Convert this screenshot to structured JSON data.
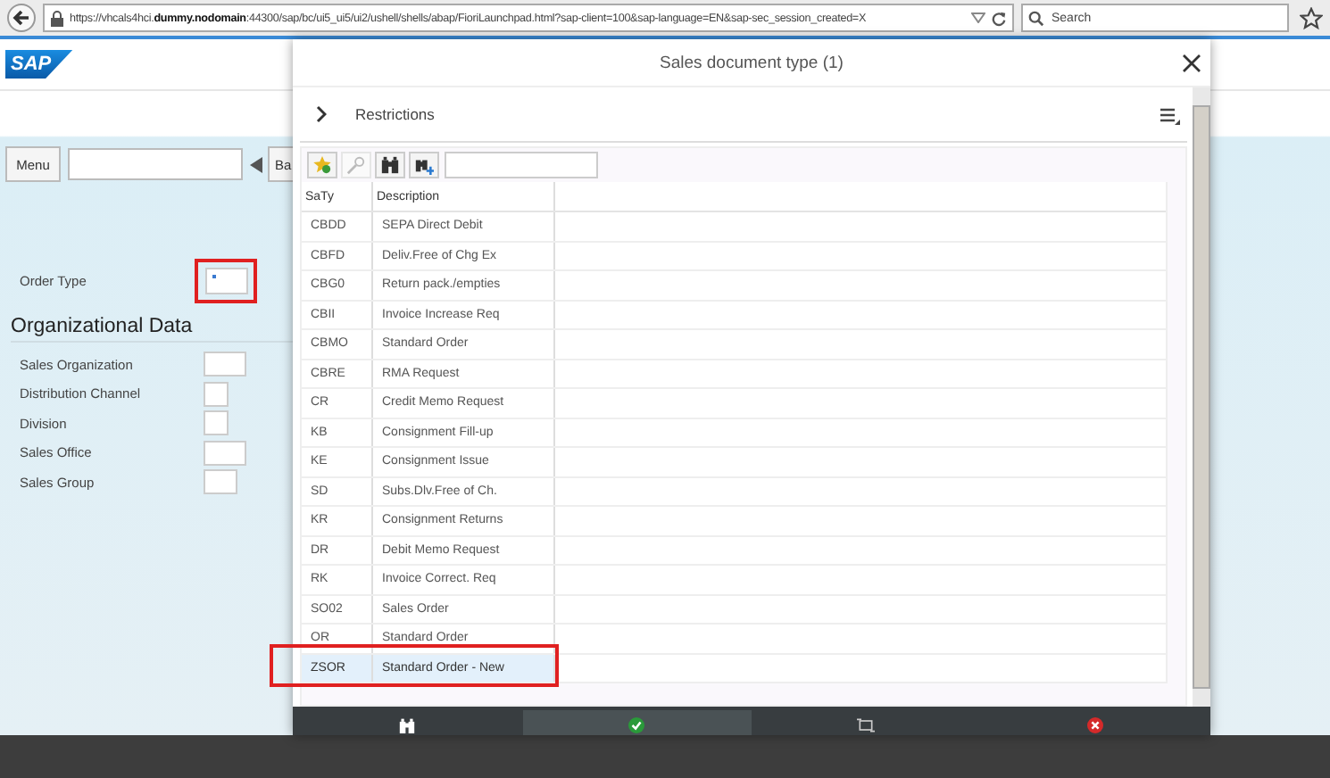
{
  "browser": {
    "url": "https://vhcals4hci.**dummy.nodomain**:44300/sap/bc/ui5_ui5/ui2/ushell/shells/abap/FioriLaunchpad.html?sap-client=100&sap-language=EN&sap-sec_session_created=X",
    "search": {
      "placeholder": "Search"
    }
  },
  "header": {
    "logo": "SAP"
  },
  "toolbar": {
    "menu": "Menu",
    "back_button": "Ba"
  },
  "form": {
    "order_type": {
      "label": "Order Type",
      "highlighted": true
    },
    "section_title": "Organizational Data",
    "fields": [
      {
        "label": "Sales Organization"
      },
      {
        "label": "Distribution Channel"
      },
      {
        "label": "Division"
      },
      {
        "label": "Sales Office"
      },
      {
        "label": "Sales Group"
      }
    ]
  },
  "dialog": {
    "title": "Sales document type (1)",
    "restrictions": "Restrictions",
    "toolbar": [
      {
        "kind": "favorite",
        "disabled": false
      },
      {
        "kind": "key",
        "disabled": true
      },
      {
        "kind": "find",
        "disabled": false
      },
      {
        "kind": "find-next",
        "disabled": false
      }
    ],
    "columns": [
      "SaTy",
      "Description"
    ],
    "rows": [
      {
        "code": "CBDD",
        "description": "SEPA Direct Debit",
        "selected": false
      },
      {
        "code": "CBFD",
        "description": "Deliv.Free of Chg Ex",
        "selected": false
      },
      {
        "code": "CBG0",
        "description": "Return pack./empties",
        "selected": false
      },
      {
        "code": "CBII",
        "description": "Invoice Increase Req",
        "selected": false
      },
      {
        "code": "CBMO",
        "description": "Standard Order",
        "selected": false
      },
      {
        "code": "CBRE",
        "description": "RMA Request",
        "selected": false
      },
      {
        "code": "CR",
        "description": "Credit Memo Request",
        "selected": false
      },
      {
        "code": "KB",
        "description": "Consignment Fill-up",
        "selected": false
      },
      {
        "code": "KE",
        "description": "Consignment Issue",
        "selected": false
      },
      {
        "code": "SD",
        "description": "Subs.Dlv.Free of Ch.",
        "selected": false
      },
      {
        "code": "KR",
        "description": "Consignment Returns",
        "selected": false
      },
      {
        "code": "DR",
        "description": "Debit Memo Request",
        "selected": false
      },
      {
        "code": "RK",
        "description": "Invoice Correct. Req",
        "selected": false
      },
      {
        "code": "SO02",
        "description": "Sales Order",
        "selected": false
      },
      {
        "code": "OR",
        "description": "Standard Order",
        "selected": false
      },
      {
        "code": "ZSOR",
        "description": "Standard Order - New",
        "selected": true,
        "highlighted": true
      }
    ],
    "footer_buttons": [
      {
        "kind": "find",
        "selected": false
      },
      {
        "kind": "confirm",
        "selected": true
      },
      {
        "kind": "multiple",
        "selected": false
      },
      {
        "kind": "cancel",
        "selected": false
      }
    ]
  }
}
